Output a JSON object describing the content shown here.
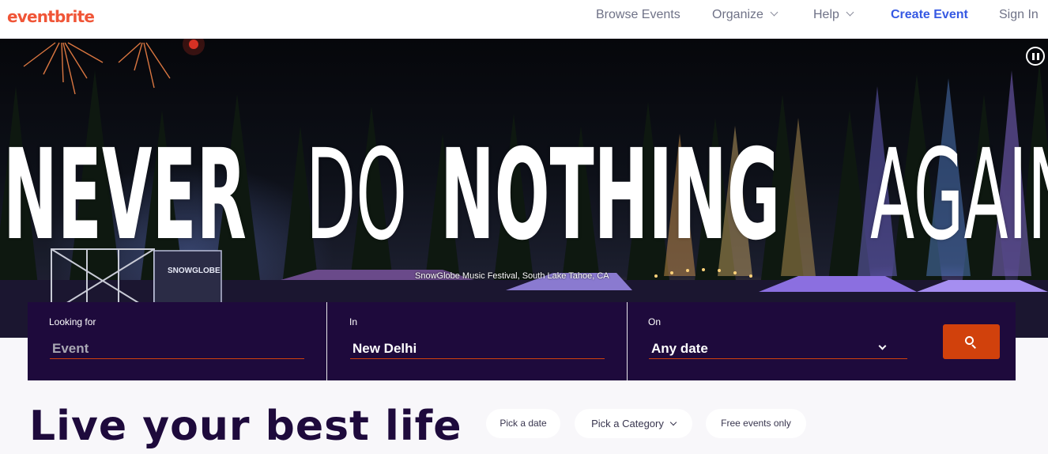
{
  "header": {
    "logo": "eventbrite",
    "nav": {
      "browse": "Browse Events",
      "organize": "Organize",
      "help": "Help",
      "create": "Create Event",
      "signin": "Sign In"
    }
  },
  "hero": {
    "headline": [
      "NEVER",
      "DO",
      "NOTHING",
      "AGAIN"
    ],
    "caption": "SnowGlobe Music Festival, South Lake Tahoe, CA",
    "stage_sign": "SNOWGLOBE"
  },
  "search": {
    "looking_for": {
      "label": "Looking for",
      "placeholder": "Event",
      "value": ""
    },
    "in": {
      "label": "In",
      "value": "New Delhi"
    },
    "on": {
      "label": "On",
      "value": "Any date"
    }
  },
  "main": {
    "tagline": "Live your best life",
    "filters": {
      "date": "Pick a date",
      "category": "Pick a Category",
      "free": "Free events only"
    }
  },
  "colors": {
    "brand": "#f05537",
    "search_bar": "#1e0a3c",
    "search_button": "#d1410c",
    "create_link": "#3659e3"
  }
}
